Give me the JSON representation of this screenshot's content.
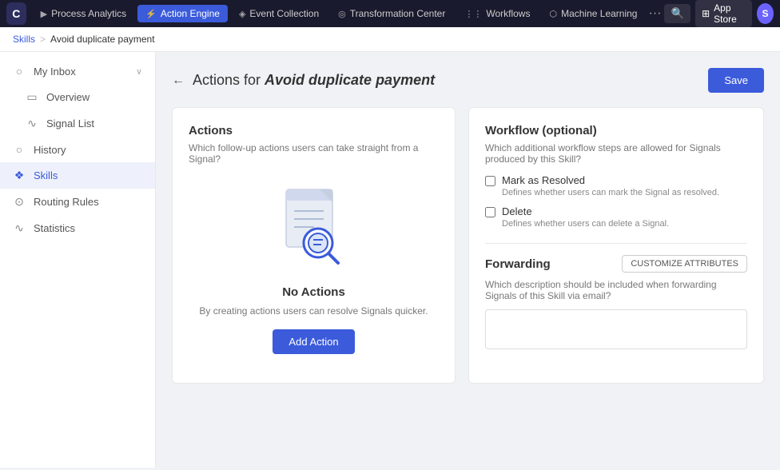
{
  "topnav": {
    "logo": "C",
    "items": [
      {
        "id": "process-analytics",
        "label": "Process Analytics",
        "icon": "▶",
        "active": false
      },
      {
        "id": "action-engine",
        "label": "Action Engine",
        "icon": "⚡",
        "active": true
      },
      {
        "id": "event-collection",
        "label": "Event Collection",
        "icon": "◈",
        "active": false
      },
      {
        "id": "transformation-center",
        "label": "Transformation Center",
        "icon": "◎",
        "active": false
      },
      {
        "id": "workflows",
        "label": "Workflows",
        "icon": "⋮⋮",
        "active": false
      },
      {
        "id": "machine-learning",
        "label": "Machine Learning",
        "icon": "⬡",
        "active": false
      }
    ],
    "dots": "···",
    "appstore_label": "App Store",
    "avatar_letter": "S"
  },
  "breadcrumb": {
    "skills_label": "Skills",
    "separator": ">",
    "current": "Avoid duplicate payment"
  },
  "sidebar": {
    "items": [
      {
        "id": "my-inbox",
        "label": "My Inbox",
        "icon": "○",
        "has_arrow": true
      },
      {
        "id": "overview",
        "label": "Overview",
        "icon": "▭",
        "sub": true
      },
      {
        "id": "signal-list",
        "label": "Signal List",
        "icon": "∿",
        "sub": true
      },
      {
        "id": "history",
        "label": "History",
        "icon": "○"
      },
      {
        "id": "skills",
        "label": "Skills",
        "icon": "❖",
        "active": true
      },
      {
        "id": "routing-rules",
        "label": "Routing Rules",
        "icon": "⊙"
      },
      {
        "id": "statistics",
        "label": "Statistics",
        "icon": "∿"
      }
    ]
  },
  "page": {
    "back_icon": "←",
    "title_prefix": "Actions for ",
    "title_italic": "Avoid duplicate payment",
    "save_label": "Save"
  },
  "actions_card": {
    "title": "Actions",
    "subtitle": "Which follow-up actions users can take straight from a Signal?",
    "no_actions_title": "No Actions",
    "no_actions_desc": "By creating actions users can resolve Signals quicker.",
    "add_action_label": "Add Action"
  },
  "workflow_card": {
    "title": "Workflow (optional)",
    "description": "Which additional workflow steps are allowed for Signals produced by this Skill?",
    "options": [
      {
        "id": "mark-resolved",
        "label": "Mark as Resolved",
        "description": "Defines whether users can mark the Signal as resolved.",
        "checked": false
      },
      {
        "id": "delete",
        "label": "Delete",
        "description": "Defines whether users can delete a Signal.",
        "checked": false
      }
    ],
    "forwarding_title": "Forwarding",
    "customize_label": "CUSTOMIZE ATTRIBUTES",
    "forwarding_desc": "Which description should be included when forwarding Signals of this Skill via email?",
    "forwarding_placeholder": ""
  }
}
